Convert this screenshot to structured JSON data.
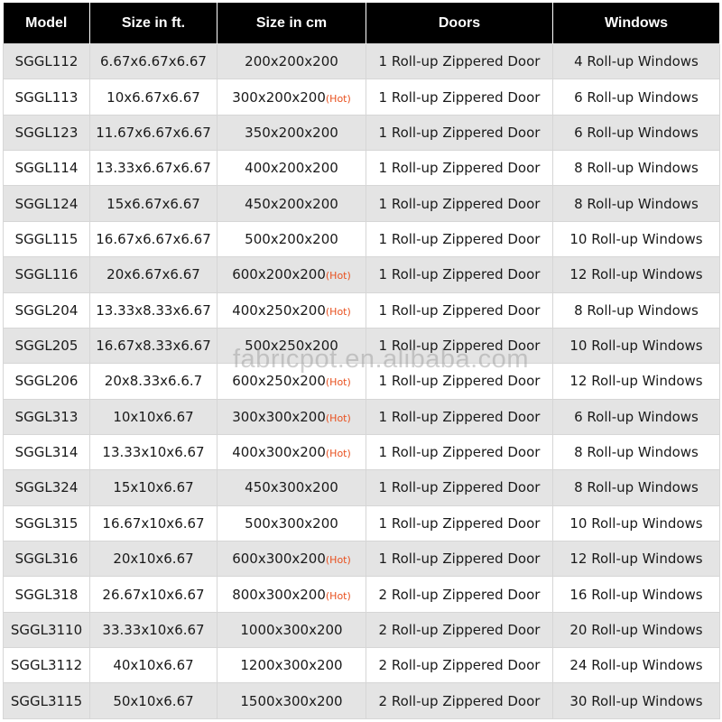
{
  "table": {
    "headers": [
      "Model",
      "Size in ft.",
      "Size in cm",
      "Doors",
      "Windows"
    ],
    "hot_label": "(Hot)",
    "rows": [
      {
        "model": "SGGL112",
        "ft": "6.67x6.67x6.67",
        "cm": "200x200x200",
        "hot": false,
        "doors": "1 Roll-up Zippered Door",
        "windows": "4 Roll-up Windows"
      },
      {
        "model": "SGGL113",
        "ft": "10x6.67x6.67",
        "cm": "300x200x200",
        "hot": true,
        "doors": "1 Roll-up Zippered Door",
        "windows": "6 Roll-up Windows"
      },
      {
        "model": "SGGL123",
        "ft": "11.67x6.67x6.67",
        "cm": "350x200x200",
        "hot": false,
        "doors": "1 Roll-up Zippered Door",
        "windows": "6 Roll-up Windows"
      },
      {
        "model": "SGGL114",
        "ft": "13.33x6.67x6.67",
        "cm": "400x200x200",
        "hot": false,
        "doors": "1 Roll-up Zippered Door",
        "windows": "8 Roll-up Windows"
      },
      {
        "model": "SGGL124",
        "ft": "15x6.67x6.67",
        "cm": "450x200x200",
        "hot": false,
        "doors": "1 Roll-up Zippered Door",
        "windows": "8 Roll-up Windows"
      },
      {
        "model": "SGGL115",
        "ft": "16.67x6.67x6.67",
        "cm": "500x200x200",
        "hot": false,
        "doors": "1 Roll-up Zippered Door",
        "windows": "10 Roll-up Windows"
      },
      {
        "model": "SGGL116",
        "ft": "20x6.67x6.67",
        "cm": "600x200x200",
        "hot": true,
        "doors": "1 Roll-up Zippered Door",
        "windows": "12 Roll-up Windows"
      },
      {
        "model": "SGGL204",
        "ft": "13.33x8.33x6.67",
        "cm": "400x250x200",
        "hot": true,
        "doors": "1 Roll-up Zippered Door",
        "windows": "8 Roll-up Windows"
      },
      {
        "model": "SGGL205",
        "ft": "16.67x8.33x6.67",
        "cm": "500x250x200",
        "hot": false,
        "doors": "1 Roll-up Zippered Door",
        "windows": "10 Roll-up Windows"
      },
      {
        "model": "SGGL206",
        "ft": "20x8.33x6.6.7",
        "cm": "600x250x200",
        "hot": true,
        "doors": "1 Roll-up Zippered Door",
        "windows": "12 Roll-up Windows"
      },
      {
        "model": "SGGL313",
        "ft": "10x10x6.67",
        "cm": "300x300x200",
        "hot": true,
        "doors": "1 Roll-up Zippered Door",
        "windows": "6 Roll-up Windows"
      },
      {
        "model": "SGGL314",
        "ft": "13.33x10x6.67",
        "cm": "400x300x200",
        "hot": true,
        "doors": "1 Roll-up Zippered Door",
        "windows": "8 Roll-up Windows"
      },
      {
        "model": "SGGL324",
        "ft": "15x10x6.67",
        "cm": "450x300x200",
        "hot": false,
        "doors": "1 Roll-up Zippered Door",
        "windows": "8 Roll-up Windows"
      },
      {
        "model": "SGGL315",
        "ft": "16.67x10x6.67",
        "cm": "500x300x200",
        "hot": false,
        "doors": "1 Roll-up Zippered Door",
        "windows": "10 Roll-up Windows"
      },
      {
        "model": "SGGL316",
        "ft": "20x10x6.67",
        "cm": "600x300x200",
        "hot": true,
        "doors": "1 Roll-up Zippered Door",
        "windows": "12 Roll-up Windows"
      },
      {
        "model": "SGGL318",
        "ft": "26.67x10x6.67",
        "cm": "800x300x200",
        "hot": true,
        "doors": "2 Roll-up Zippered Door",
        "windows": "16 Roll-up Windows"
      },
      {
        "model": "SGGL3110",
        "ft": "33.33x10x6.67",
        "cm": "1000x300x200",
        "hot": false,
        "doors": "2 Roll-up Zippered Door",
        "windows": "20 Roll-up Windows"
      },
      {
        "model": "SGGL3112",
        "ft": "40x10x6.67",
        "cm": "1200x300x200",
        "hot": false,
        "doors": "2 Roll-up Zippered Door",
        "windows": "24 Roll-up Windows"
      },
      {
        "model": "SGGL3115",
        "ft": "50x10x6.67",
        "cm": "1500x300x200",
        "hot": false,
        "doors": "2 Roll-up Zippered Door",
        "windows": "30 Roll-up Windows"
      }
    ]
  },
  "watermark": "fabricpot.en.alibaba.com",
  "colors": {
    "header_bg": "#000000",
    "header_text": "#ffffff",
    "row_shade": "#e4e4e4",
    "hot_text": "#e8501e"
  }
}
